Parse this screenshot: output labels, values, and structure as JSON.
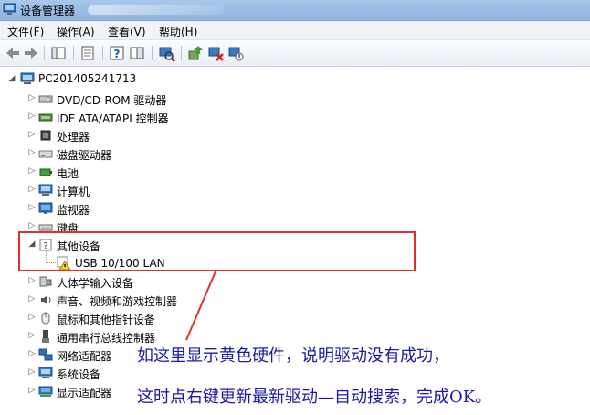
{
  "window": {
    "title": "设备管理器"
  },
  "menu": {
    "file": "文件(F)",
    "action": "操作(A)",
    "view": "查看(V)",
    "help": "帮助(H)"
  },
  "tree": {
    "root": "PC201405241713",
    "items": [
      {
        "label": "DVD/CD-ROM 驱动器",
        "icon": "dvd-drive-icon"
      },
      {
        "label": "IDE ATA/ATAPI 控制器",
        "icon": "ide-controller-icon"
      },
      {
        "label": "处理器",
        "icon": "processor-icon"
      },
      {
        "label": "磁盘驱动器",
        "icon": "disk-drive-icon"
      },
      {
        "label": "电池",
        "icon": "battery-icon"
      },
      {
        "label": "计算机",
        "icon": "computer-icon"
      },
      {
        "label": "监视器",
        "icon": "monitor-icon"
      },
      {
        "label": "键盘",
        "icon": "keyboard-icon"
      },
      {
        "label": "其他设备",
        "icon": "unknown-device-icon"
      },
      {
        "label": "USB 10/100 LAN",
        "icon": "warning-device-icon"
      },
      {
        "label": "人体学输入设备",
        "icon": "hid-icon"
      },
      {
        "label": "声音、视频和游戏控制器",
        "icon": "speaker-icon"
      },
      {
        "label": "鼠标和其他指针设备",
        "icon": "mouse-icon"
      },
      {
        "label": "通用串行总线控制器",
        "icon": "usb-icon"
      },
      {
        "label": "网络适配器",
        "icon": "network-icon"
      },
      {
        "label": "系统设备",
        "icon": "system-device-icon"
      },
      {
        "label": "显示适配器",
        "icon": "display-adapter-icon"
      }
    ]
  },
  "annotation": {
    "line1": "如这里显示黄色硬件，说明驱动没有成功，",
    "line2": "这时点右键更新最新驱动—自动搜索，完成OK。"
  },
  "colors": {
    "highlight": "#e03030",
    "annotation_text": "#1a1aa8"
  }
}
